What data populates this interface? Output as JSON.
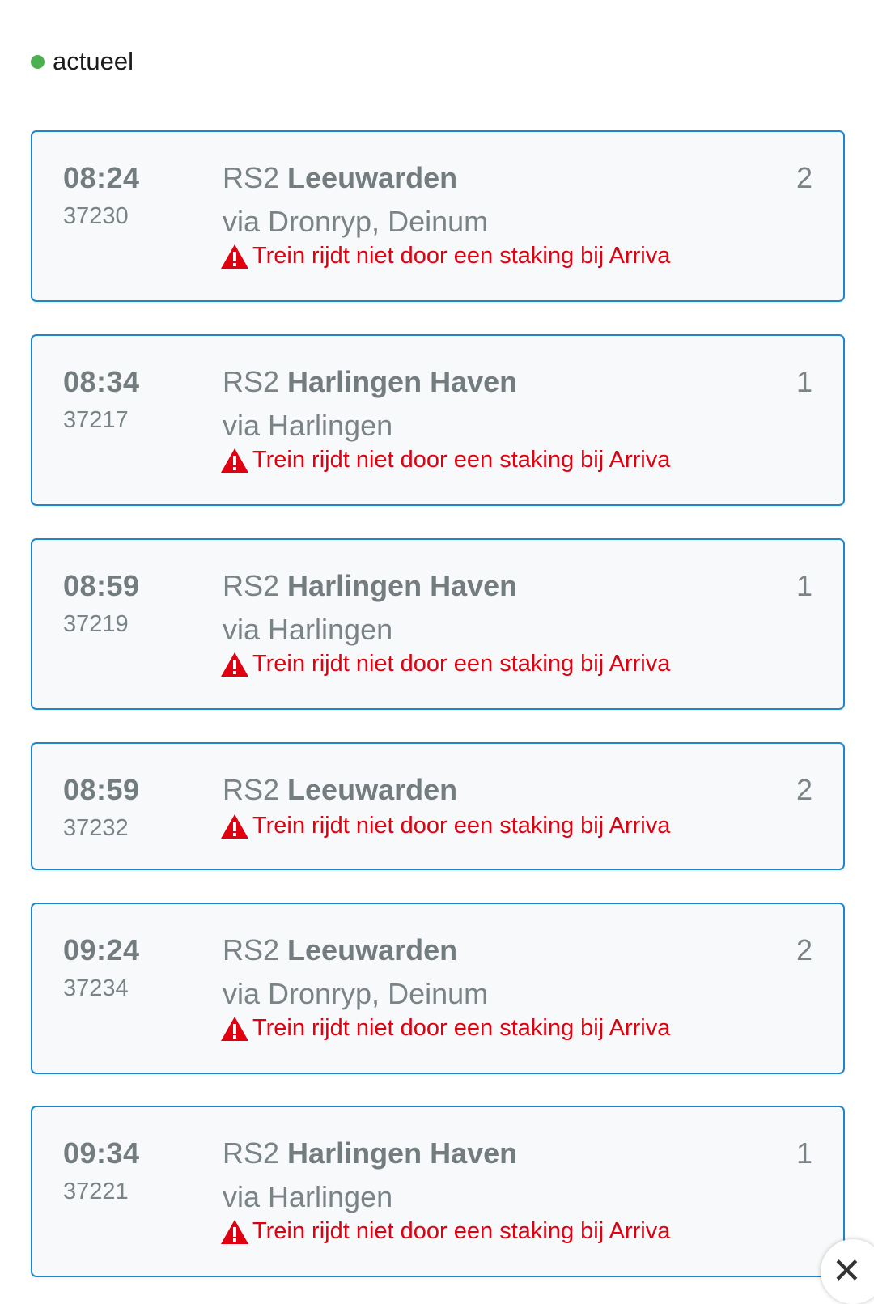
{
  "status": {
    "label": "actueel",
    "dot_color": "#4caf50"
  },
  "warning_icon": "warning-triangle-icon",
  "departures": [
    {
      "time": "08:24",
      "train_number": "37230",
      "line": "RS2",
      "destination": "Leeuwarden",
      "via": "via Dronryp, Deinum",
      "track": "2",
      "notice": "Trein rijdt niet door een staking bij Arriva"
    },
    {
      "time": "08:34",
      "train_number": "37217",
      "line": "RS2",
      "destination": "Harlingen Haven",
      "via": "via Harlingen",
      "track": "1",
      "notice": "Trein rijdt niet door een staking bij Arriva"
    },
    {
      "time": "08:59",
      "train_number": "37219",
      "line": "RS2",
      "destination": "Harlingen Haven",
      "via": "via Harlingen",
      "track": "1",
      "notice": "Trein rijdt niet door een staking bij Arriva"
    },
    {
      "time": "08:59",
      "train_number": "37232",
      "line": "RS2",
      "destination": "Leeuwarden",
      "via": "",
      "track": "2",
      "notice": "Trein rijdt niet door een staking bij Arriva"
    },
    {
      "time": "09:24",
      "train_number": "37234",
      "line": "RS2",
      "destination": "Leeuwarden",
      "via": "via Dronryp, Deinum",
      "track": "2",
      "notice": "Trein rijdt niet door een staking bij Arriva"
    },
    {
      "time": "09:34",
      "train_number": "37221",
      "line": "RS2",
      "destination": "Harlingen Haven",
      "via": "via Harlingen",
      "track": "1",
      "notice": "Trein rijdt niet door een staking bij Arriva"
    }
  ],
  "close_button": {
    "icon": "close-icon",
    "symbol": "✕"
  }
}
